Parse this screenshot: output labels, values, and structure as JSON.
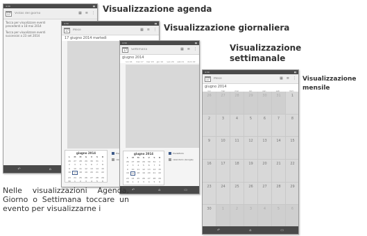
{
  "labels": {
    "agenda": "Visualizzazione agenda",
    "day": "Visualizzazione giornaliera",
    "week_line1": "Visualizzazione",
    "week_line2": "settimanale",
    "month_line1": "Visualizzazione",
    "month_line2": "mensile"
  },
  "body_text": "Nelle visualizzazioni Agenda, Giorno o Settimana toccare un evento per visualizzarne i",
  "agenda_screen": {
    "title": "Vistas del giorno",
    "status_time": "4:30",
    "items": [
      "Tocca per visualizzare eventi precedenti a 18 mai 2014",
      "Tocca per visualizzare eventi successivi a 23 set 2014"
    ]
  },
  "day_screen": {
    "title": "Mese",
    "date_header": "17 giugno 2014 martedì",
    "status_time": "4:30",
    "mini_calendar": {
      "title": "giugno 2014",
      "weekdays": [
        "L",
        "M",
        "M",
        "G",
        "V",
        "S",
        "D"
      ],
      "days": [
        "26",
        "27",
        "28",
        "29",
        "30",
        "31",
        "1",
        "2",
        "3",
        "4",
        "5",
        "6",
        "7",
        "8",
        "9",
        "10",
        "11",
        "12",
        "13",
        "14",
        "15",
        "16",
        "17",
        "18",
        "19",
        "20",
        "21",
        "22",
        "23",
        "24",
        "25",
        "26",
        "27",
        "28",
        "29",
        "30",
        "1",
        "2",
        "3",
        "4",
        "5",
        "6"
      ]
    },
    "legend": [
      "Predefinito",
      "calendario (Google)"
    ]
  },
  "week_screen": {
    "title": "Settimana",
    "header": "giugno 2014",
    "status_time": "4:30",
    "day_cols": [
      "lun 16",
      "mar 17",
      "mer 18",
      "gio 19",
      "ven 20",
      "sab 21",
      "dom 22"
    ],
    "mini_calendar": {
      "title": "giugno 2014",
      "weekdays": [
        "L",
        "M",
        "M",
        "G",
        "V",
        "S",
        "D"
      ],
      "days": [
        "26",
        "27",
        "28",
        "29",
        "30",
        "31",
        "1",
        "2",
        "3",
        "4",
        "5",
        "6",
        "7",
        "8",
        "9",
        "10",
        "11",
        "12",
        "13",
        "14",
        "15",
        "16",
        "17",
        "18",
        "19",
        "20",
        "21",
        "22",
        "23",
        "24",
        "25",
        "26",
        "27",
        "28",
        "29",
        "30",
        "1",
        "2",
        "3",
        "4",
        "5",
        "6"
      ]
    },
    "legend": [
      "Predefinito",
      "calendario (Google)"
    ]
  },
  "month_screen": {
    "title": "Mese",
    "header": "giugno 2014",
    "status_time": "4:30",
    "weekdays": [
      "lun",
      "mar",
      "mer",
      "gio",
      "ven",
      "sab",
      "dom"
    ],
    "weeks": [
      [
        "26",
        "27",
        "28",
        "29",
        "30",
        "31",
        "1"
      ],
      [
        "2",
        "3",
        "4",
        "5",
        "6",
        "7",
        "8"
      ],
      [
        "9",
        "10",
        "11",
        "12",
        "13",
        "14",
        "15"
      ],
      [
        "16",
        "17",
        "18",
        "19",
        "20",
        "21",
        "22"
      ],
      [
        "23",
        "24",
        "25",
        "26",
        "27",
        "28",
        "29"
      ],
      [
        "30",
        "1",
        "2",
        "3",
        "4",
        "5",
        "6"
      ]
    ]
  },
  "icons": [
    "calendar-icon",
    "today-icon",
    "menu-icon",
    "overflow-icon",
    "back-icon",
    "home-icon",
    "recents-icon"
  ]
}
